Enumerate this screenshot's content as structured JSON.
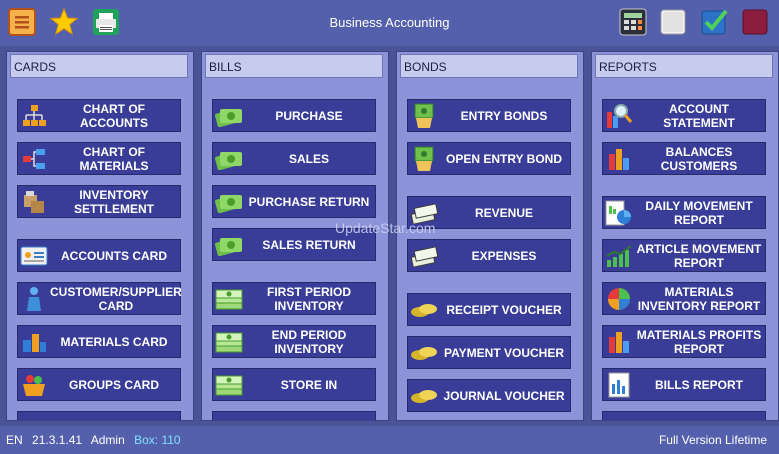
{
  "app": {
    "title": "Business Accounting"
  },
  "watermark": "UpdateStar.com",
  "status": {
    "lang": "EN",
    "version": "21.3.1.41",
    "user": "Admin",
    "box": "Box: 110",
    "license": "Full Version Lifetime"
  },
  "columns": [
    {
      "header": "CARDS",
      "buttons": [
        {
          "label": "CHART OF ACCOUNTS",
          "icon": "org-chart-icon"
        },
        {
          "label": "CHART OF MATERIALS",
          "icon": "tree-icon"
        },
        {
          "label": "INVENTORY SETTLEMENT",
          "icon": "boxes-icon"
        },
        {
          "label": "ACCOUNTS CARD",
          "icon": "id-card-icon"
        },
        {
          "label": "CUSTOMER/SUPPLIER CARD",
          "icon": "person-icon"
        },
        {
          "label": "MATERIALS CARD",
          "icon": "products-icon"
        },
        {
          "label": "GROUPS CARD",
          "icon": "basket-icon"
        }
      ]
    },
    {
      "header": "BILLS",
      "buttons": [
        {
          "label": "PURCHASE",
          "icon": "money-icon"
        },
        {
          "label": "SALES",
          "icon": "money-icon"
        },
        {
          "label": "PURCHASE RETURN",
          "icon": "money-icon"
        },
        {
          "label": "SALES RETURN",
          "icon": "money-icon"
        },
        {
          "label": "FIRST PERIOD INVENTORY",
          "icon": "cash-stack-icon"
        },
        {
          "label": "END PERIOD INVENTORY",
          "icon": "cash-stack-icon"
        },
        {
          "label": "STORE IN",
          "icon": "cash-stack-icon"
        }
      ]
    },
    {
      "header": "BONDS",
      "buttons": [
        {
          "label": "ENTRY BONDS",
          "icon": "money-bag-icon"
        },
        {
          "label": "OPEN ENTRY BOND",
          "icon": "money-bag-icon"
        },
        {
          "label": "REVENUE",
          "icon": "bills-icon"
        },
        {
          "label": "EXPENSES",
          "icon": "bills-icon"
        },
        {
          "label": "RECEIPT VOUCHER",
          "icon": "coins-icon"
        },
        {
          "label": "PAYMENT VOUCHER",
          "icon": "coins-icon"
        },
        {
          "label": "JOURNAL VOUCHER",
          "icon": "coins-icon"
        }
      ]
    },
    {
      "header": "REPORTS",
      "buttons": [
        {
          "label": "ACCOUNT STATEMENT",
          "icon": "magnifier-chart-icon"
        },
        {
          "label": "BALANCES CUSTOMERS",
          "icon": "bar-chart-icon"
        },
        {
          "label": "DAILY MOVEMENT REPORT",
          "icon": "pie-report-icon"
        },
        {
          "label": "ARTICLE MOVEMENT REPORT",
          "icon": "trend-chart-icon"
        },
        {
          "label": "MATERIALS INVENTORY REPORT",
          "icon": "pie-chart-icon"
        },
        {
          "label": "MATERIALS PROFITS REPORT",
          "icon": "bar-chart-icon"
        },
        {
          "label": "BILLS REPORT",
          "icon": "document-chart-icon"
        }
      ]
    }
  ]
}
